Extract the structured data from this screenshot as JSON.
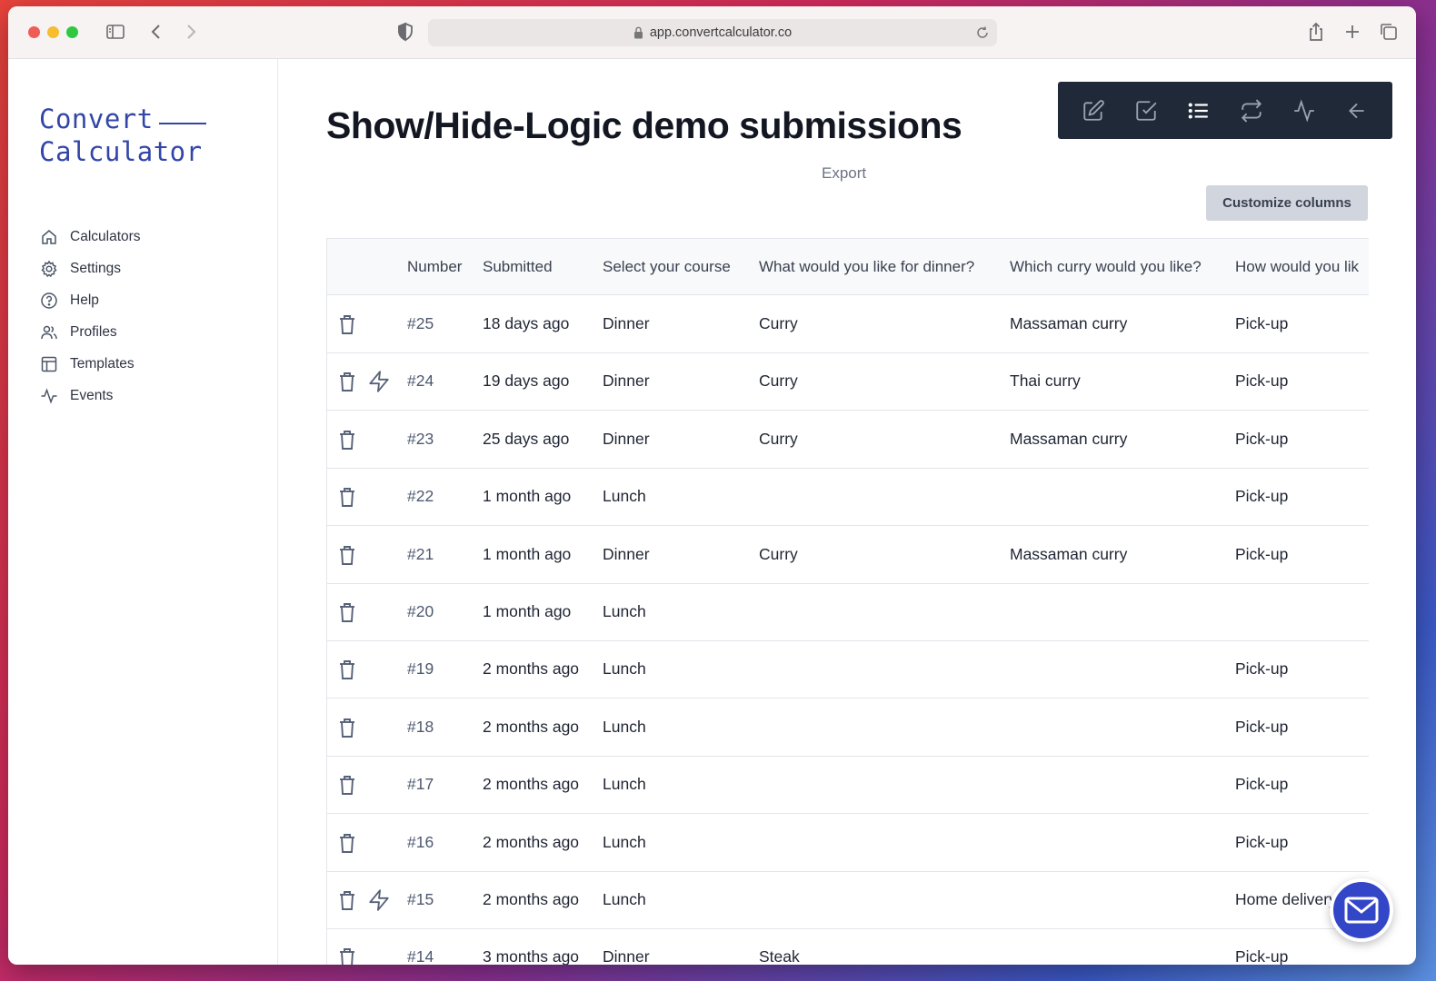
{
  "browser": {
    "url": "app.convertcalculator.co"
  },
  "sidebar": {
    "logo_line1": "Convert",
    "logo_line2": "Calculator",
    "items": [
      {
        "label": "Calculators",
        "icon": "home-icon"
      },
      {
        "label": "Settings",
        "icon": "gear-icon"
      },
      {
        "label": "Help",
        "icon": "question-circle-icon"
      },
      {
        "label": "Profiles",
        "icon": "users-icon"
      },
      {
        "label": "Templates",
        "icon": "layout-icon"
      },
      {
        "label": "Events",
        "icon": "activity-icon"
      }
    ]
  },
  "main": {
    "title": "Show/Hide-Logic demo submissions",
    "export_label": "Export",
    "customize_label": "Customize columns",
    "toolbar": [
      {
        "icon": "edit-icon",
        "active": false
      },
      {
        "icon": "check-square-icon",
        "active": false
      },
      {
        "icon": "list-icon",
        "active": true
      },
      {
        "icon": "repeat-icon",
        "active": false
      },
      {
        "icon": "activity-icon",
        "active": false
      },
      {
        "icon": "arrow-left-icon",
        "active": false
      }
    ]
  },
  "table": {
    "columns": [
      "Number",
      "Submitted",
      "Select your course",
      "What would you like for dinner?",
      "Which curry would you like?",
      "How would you lik"
    ],
    "rows": [
      {
        "number": "#25",
        "submitted": "18 days ago",
        "course": "Dinner",
        "dinner": "Curry",
        "curry": "Massaman curry",
        "delivery": "Pick-up",
        "bolt": false
      },
      {
        "number": "#24",
        "submitted": "19 days ago",
        "course": "Dinner",
        "dinner": "Curry",
        "curry": "Thai curry",
        "delivery": "Pick-up",
        "bolt": true
      },
      {
        "number": "#23",
        "submitted": "25 days ago",
        "course": "Dinner",
        "dinner": "Curry",
        "curry": "Massaman curry",
        "delivery": "Pick-up",
        "bolt": false
      },
      {
        "number": "#22",
        "submitted": "1 month ago",
        "course": "Lunch",
        "dinner": "",
        "curry": "",
        "delivery": "Pick-up",
        "bolt": false
      },
      {
        "number": "#21",
        "submitted": "1 month ago",
        "course": "Dinner",
        "dinner": "Curry",
        "curry": "Massaman curry",
        "delivery": "Pick-up",
        "bolt": false
      },
      {
        "number": "#20",
        "submitted": "1 month ago",
        "course": "Lunch",
        "dinner": "",
        "curry": "",
        "delivery": "",
        "bolt": false
      },
      {
        "number": "#19",
        "submitted": "2 months ago",
        "course": "Lunch",
        "dinner": "",
        "curry": "",
        "delivery": "Pick-up",
        "bolt": false
      },
      {
        "number": "#18",
        "submitted": "2 months ago",
        "course": "Lunch",
        "dinner": "",
        "curry": "",
        "delivery": "Pick-up",
        "bolt": false
      },
      {
        "number": "#17",
        "submitted": "2 months ago",
        "course": "Lunch",
        "dinner": "",
        "curry": "",
        "delivery": "Pick-up",
        "bolt": false
      },
      {
        "number": "#16",
        "submitted": "2 months ago",
        "course": "Lunch",
        "dinner": "",
        "curry": "",
        "delivery": "Pick-up",
        "bolt": false
      },
      {
        "number": "#15",
        "submitted": "2 months ago",
        "course": "Lunch",
        "dinner": "",
        "curry": "",
        "delivery": "Home delivery",
        "bolt": true
      },
      {
        "number": "#14",
        "submitted": "3 months ago",
        "course": "Dinner",
        "dinner": "Steak",
        "curry": "",
        "delivery": "Pick-up",
        "bolt": false
      }
    ]
  },
  "colors": {
    "accent": "#3346a8",
    "toolbar_bg": "#1f2937",
    "chat_bg": "#3346c8"
  }
}
